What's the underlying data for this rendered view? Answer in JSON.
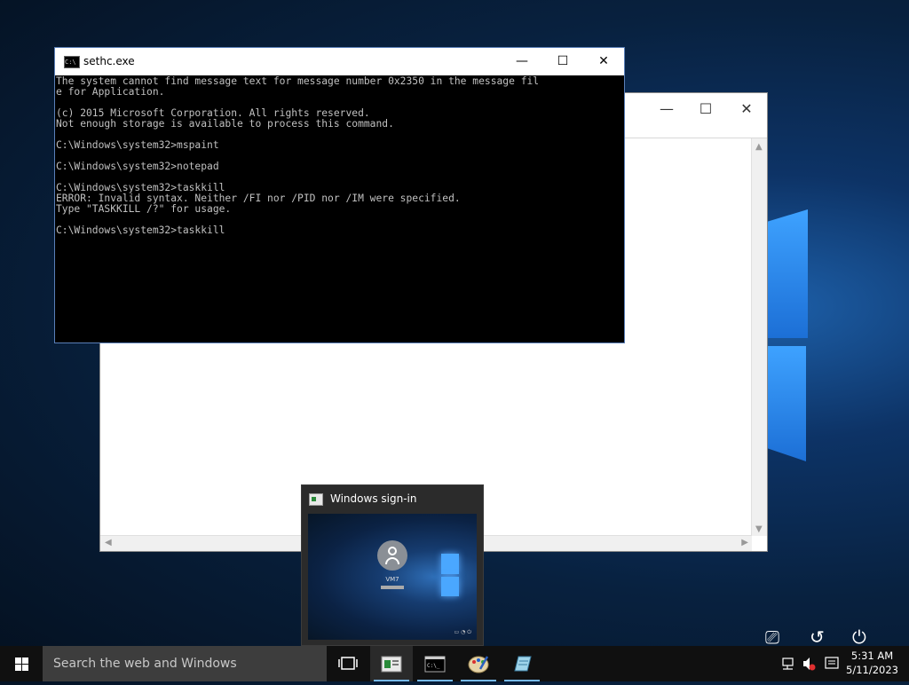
{
  "desktop": {
    "accent": "#1d5fa8"
  },
  "background_window": {
    "controls": {
      "minimize": "—",
      "maximize": "☐",
      "close": "✕"
    }
  },
  "console_window": {
    "title": "sethc.exe",
    "icon": "console-icon",
    "controls": {
      "minimize": "—",
      "maximize": "☐",
      "close": "✕"
    },
    "lines": [
      "The system cannot find message text for message number 0x2350 in the message fil",
      "e for Application.",
      "",
      "(c) 2015 Microsoft Corporation. All rights reserved.",
      "Not enough storage is available to process this command.",
      "",
      "C:\\Windows\\system32>mspaint",
      "",
      "C:\\Windows\\system32>notepad",
      "",
      "C:\\Windows\\system32>taskkill",
      "ERROR: Invalid syntax. Neither /FI nor /PID nor /IM were specified.",
      "Type \"TASKKILL /?\" for usage.",
      "",
      "C:\\Windows\\system32>taskkill"
    ]
  },
  "thumbnail": {
    "title": "Windows sign-in",
    "username": "VM7"
  },
  "taskbar": {
    "search_placeholder": "Search the web and Windows",
    "clock_time": "5:31 AM",
    "clock_date": "5/11/2023",
    "apps": [
      {
        "name": "task-view-icon"
      },
      {
        "name": "sign-in-app-icon",
        "active": true
      },
      {
        "name": "command-prompt-icon"
      },
      {
        "name": "paint-icon"
      },
      {
        "name": "notepad-icon"
      }
    ]
  }
}
